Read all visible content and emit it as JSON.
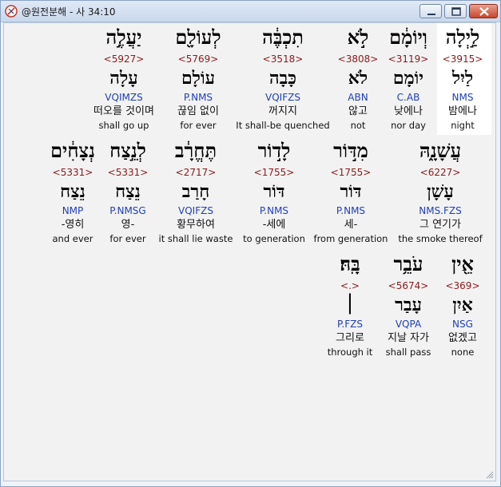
{
  "window": {
    "title": "@원전분해 - 사 34:10"
  },
  "rows": [
    {
      "words": [
        {
          "hebrew": "לַ֣יְלָה",
          "strong": "<3915>",
          "lemma": "לַיִל",
          "parse": "NMS",
          "korean": "밤에나",
          "english": "night",
          "highlight": true
        },
        {
          "hebrew": "וְיוֹמָ֔ם",
          "strong": "<3119>",
          "lemma": "יוֹמָם",
          "parse": "C.AB",
          "korean": "낮에나",
          "english": "nor day"
        },
        {
          "hebrew": "לֹ֣א",
          "strong": "<3808>",
          "lemma": "לֹא",
          "parse": "ABN",
          "korean": "않고",
          "english": "not"
        },
        {
          "hebrew": "תִכְבֶּ֔ה",
          "strong": "<3518>",
          "lemma": "כָּבָה",
          "parse": "VQIFZS",
          "korean": "꺼지지",
          "english": "It shall-be quenched"
        },
        {
          "hebrew": "לְעוֹלָ֖ם",
          "strong": "<5769>",
          "lemma": "עוֹלָם",
          "parse": "P.NMS",
          "korean": "끊임 없이",
          "english": "for ever"
        },
        {
          "hebrew": "יַעֲלֶ֣ה",
          "strong": "<5927>",
          "lemma": "עָלָה",
          "parse": "VQIMZS",
          "korean": "떠오를 것이며",
          "english": "shall go up"
        }
      ]
    },
    {
      "words": [
        {
          "hebrew": "עֲשָׁנָ֑הּ",
          "strong": "<6227>",
          "lemma": "עָשָׁן",
          "parse": "NMS.FZS",
          "korean": "그 연기가",
          "english": "the smoke thereof"
        },
        {
          "hebrew": "מִדּ֣וֹר",
          "strong": "<1755>",
          "lemma": "דּוֹר",
          "parse": "P.NMS",
          "korean": "세-",
          "english": "from generation"
        },
        {
          "hebrew": "לָד֣וֹר",
          "strong": "<1755>",
          "lemma": "דּוֹר",
          "parse": "P.NMS",
          "korean": "-세에",
          "english": "to generation"
        },
        {
          "hebrew": "תֶּחֱרָ֔ב",
          "strong": "<2717>",
          "lemma": "חָרַב",
          "parse": "VQIFZS",
          "korean": "황무하여",
          "english": "it shall lie waste"
        },
        {
          "hebrew": "לְנֵ֣צַח",
          "strong": "<5331>",
          "lemma": "נֵצַח",
          "parse": "P.NMSG",
          "korean": "영-",
          "english": "for ever"
        },
        {
          "hebrew": "נְצָחִ֔ים",
          "strong": "<5331>",
          "lemma": "נֵצַח",
          "parse": "NMP",
          "korean": "-영히",
          "english": "and ever"
        }
      ]
    },
    {
      "words": [
        {
          "hebrew": "אֵ֖ין",
          "strong": "<369>",
          "lemma": "אַיִן",
          "parse": "NSG",
          "korean": "없겠고",
          "english": "none"
        },
        {
          "hebrew": "עֹבֵ֥ר",
          "strong": "<5674>",
          "lemma": "עָבַר",
          "parse": "VQPA",
          "korean": "지날 자가",
          "english": "shall pass"
        },
        {
          "hebrew": "בָּֽהּ׃",
          "strong": "<.>",
          "lemma": "׀",
          "parse": "P.FZS",
          "korean": "그리로",
          "english": "through it"
        }
      ]
    }
  ]
}
